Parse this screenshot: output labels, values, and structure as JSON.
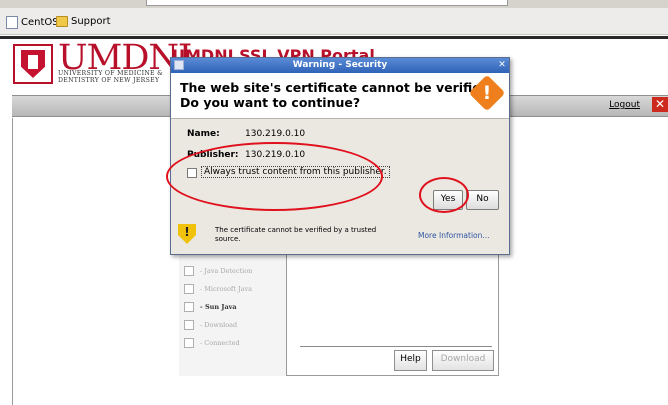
{
  "browser": {
    "bookmarks": [
      {
        "label": "CentOS",
        "icon": "page-icon"
      },
      {
        "label": "Support",
        "icon": "folder-icon"
      }
    ]
  },
  "page": {
    "logo_text": "UMDNJ",
    "logo_sub1": "UNIVERSITY OF MEDICINE &",
    "logo_sub2": "DENTISTRY OF NEW JERSEY",
    "portal_title": "UMDNJ SSL VPN Portal",
    "logout_label": "Logout",
    "logout_icon": "close-icon"
  },
  "dialog": {
    "title": "Warning - Security",
    "close_glyph": "✕",
    "headline_line1": "The web site's certificate cannot be verified.",
    "headline_line2": "Do you want to continue?",
    "name_label": "Name:",
    "name_value": "130.219.0.10",
    "publisher_label": "Publisher:",
    "publisher_value": "130.219.0.10",
    "trust_checkbox_label": "Always trust content from this publisher.",
    "trust_checked": false,
    "yes_label": "Yes",
    "no_label": "No",
    "footer_line1": "The certificate cannot be verified by a trusted",
    "footer_line2": "source.",
    "more_info_label": "More Information...",
    "warning_color": "#ee7f1c"
  },
  "wizard": {
    "steps": [
      {
        "label": "- Java Detection",
        "active": false
      },
      {
        "label": "- Microsoft Java",
        "active": false
      },
      {
        "label": "- Sun Java",
        "active": true
      },
      {
        "label": "- Download",
        "active": false
      },
      {
        "label": "- Connected",
        "active": false
      }
    ],
    "help_label": "Help",
    "download_label": "Download"
  },
  "annotation_color": "#e0101c"
}
